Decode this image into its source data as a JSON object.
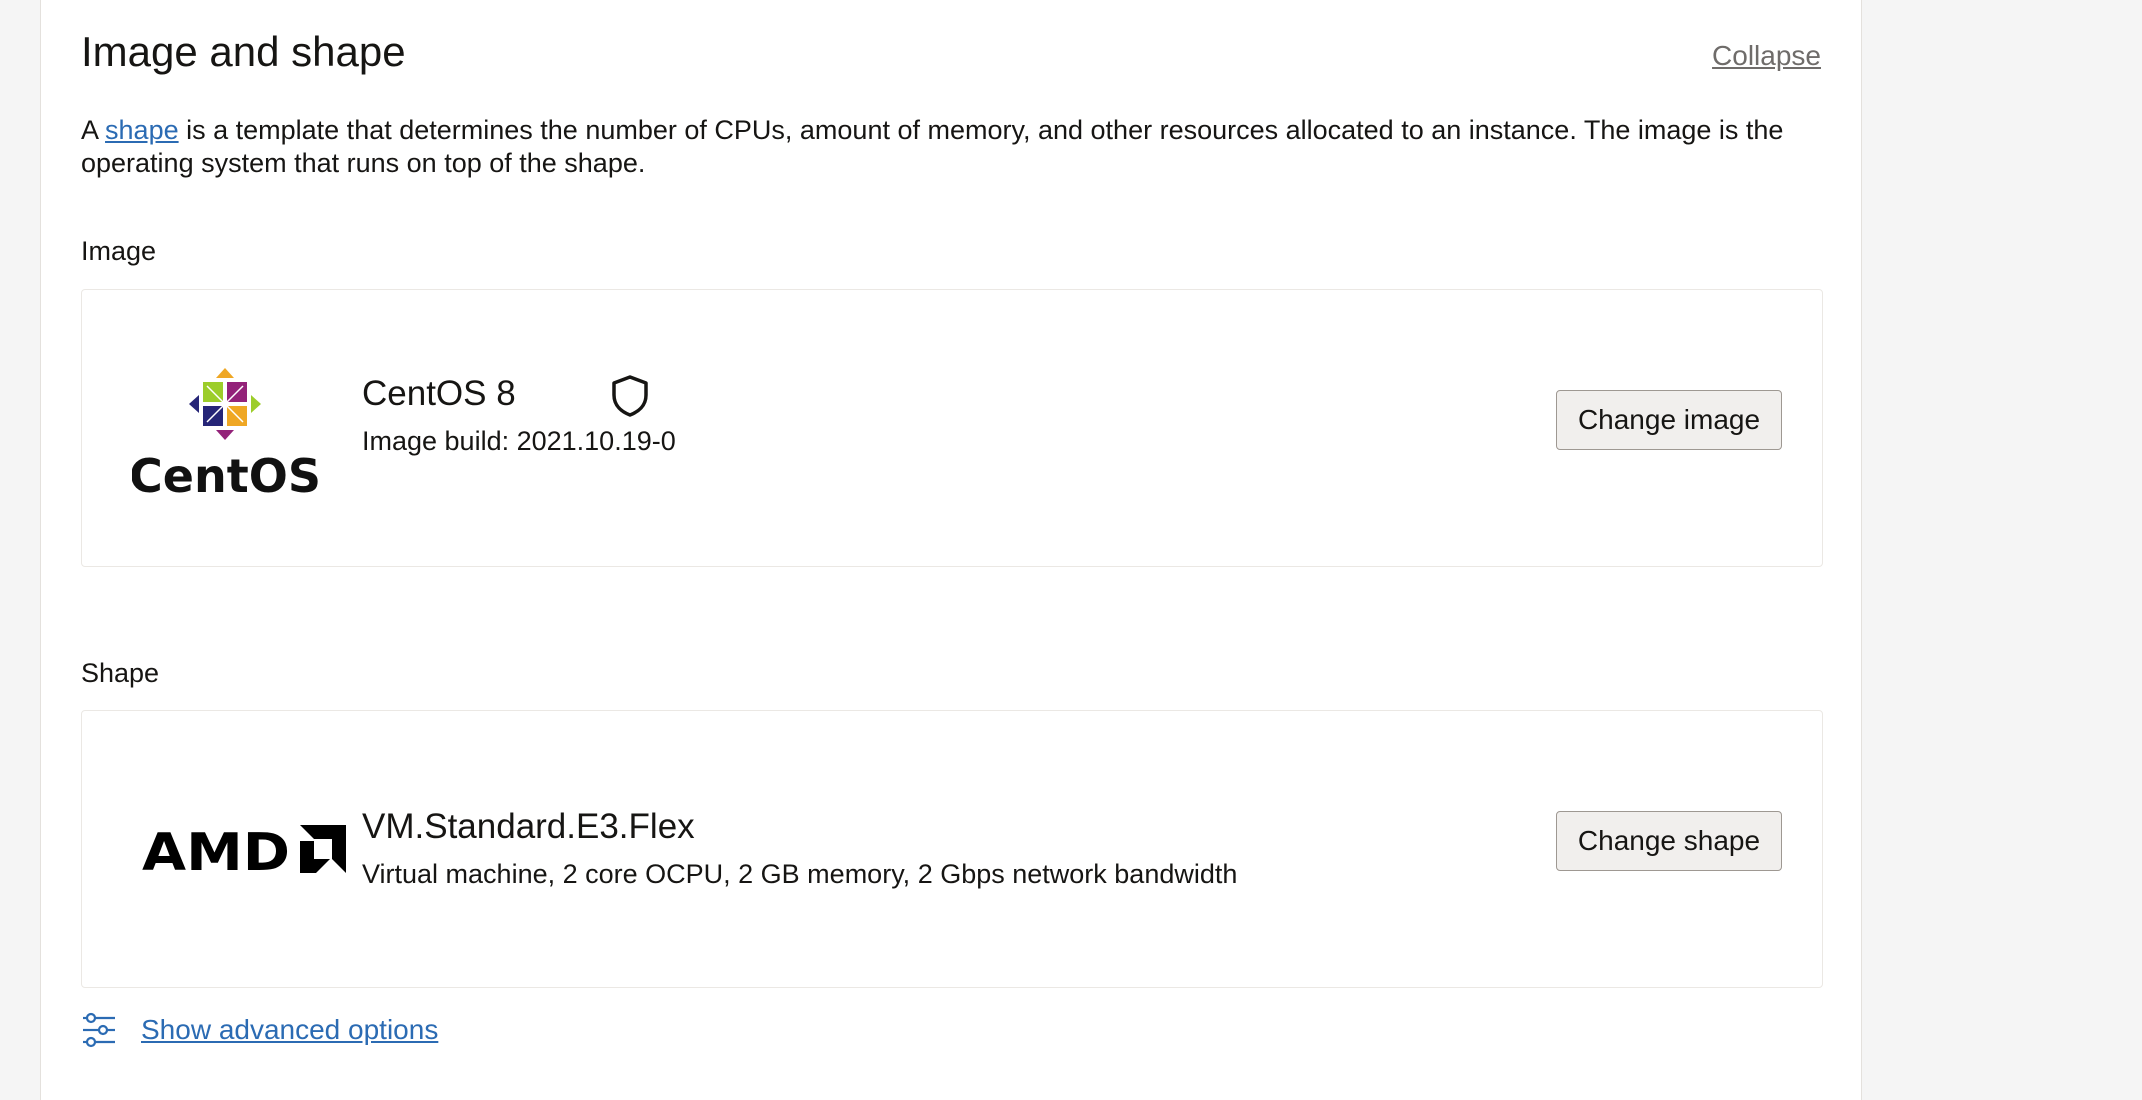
{
  "section": {
    "title": "Image and shape",
    "collapse_label": "Collapse",
    "description_prefix": "A ",
    "description_link": "shape",
    "description_suffix": " is a template that determines the number of CPUs, amount of memory, and other resources allocated to an instance. The image is the operating system that runs on top of the shape."
  },
  "image": {
    "label": "Image",
    "logo_text": "CentOS",
    "name": "CentOS 8",
    "build": "Image build: 2021.10.19-0",
    "change_button": "Change image",
    "icon": "shield-icon"
  },
  "shape": {
    "label": "Shape",
    "logo_text": "AMD",
    "name": "VM.Standard.E3.Flex",
    "details": "Virtual machine, 2 core OCPU, 2 GB memory, 2 Gbps network bandwidth",
    "change_button": "Change shape"
  },
  "advanced": {
    "label": "Show advanced options",
    "icon": "sliders-icon"
  },
  "colors": {
    "link": "#2b6bb3",
    "button_bg": "#f1efed",
    "page_bg": "#f5f5f5"
  }
}
